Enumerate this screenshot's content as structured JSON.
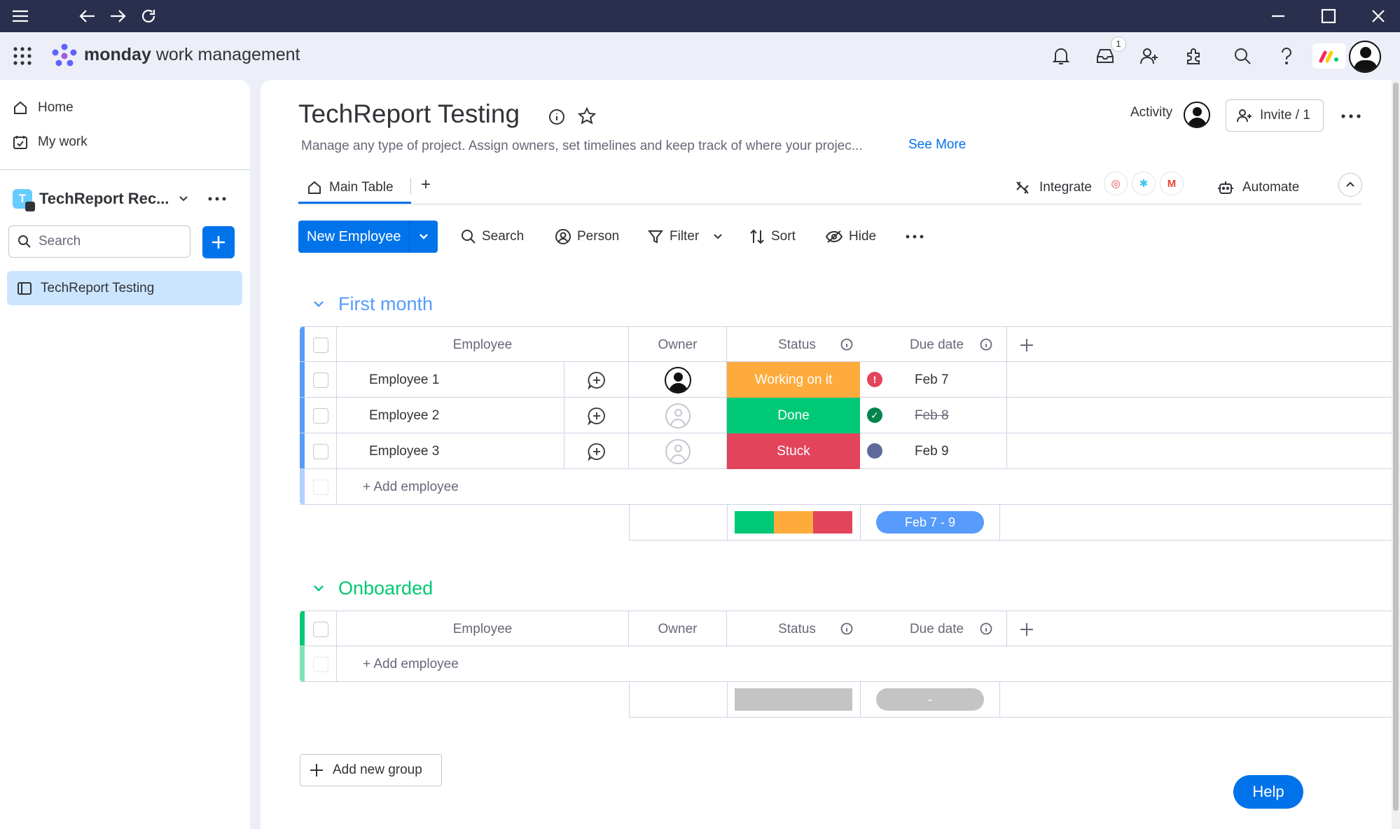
{
  "app": {
    "brand_bold": "monday",
    "brand_rest": "work management",
    "inbox_badge": "1"
  },
  "sidebar": {
    "home": "Home",
    "my_work": "My work",
    "workspace_letter": "T",
    "workspace_name": "TechReport Rec...",
    "search_placeholder": "Search",
    "board_item": "TechReport Testing"
  },
  "board": {
    "title": "TechReport Testing",
    "description": "Manage any type of project. Assign owners, set timelines and keep track of where your projec...",
    "see_more": "See More",
    "activity": "Activity",
    "invite": "Invite / 1",
    "tab_main": "Main Table",
    "tab_add": "+",
    "integrate": "Integrate",
    "automate": "Automate"
  },
  "toolbar": {
    "new_item": "New Employee",
    "search": "Search",
    "person": "Person",
    "filter": "Filter",
    "sort": "Sort",
    "hide": "Hide"
  },
  "columns": {
    "employee": "Employee",
    "owner": "Owner",
    "status": "Status",
    "due_date": "Due date"
  },
  "groups": [
    {
      "name": "First month",
      "color": "#579bfc",
      "rows": [
        {
          "name": "Employee 1",
          "owner": "assigned",
          "status": "Working on it",
          "status_color": "#fdab3d",
          "date": "Feb 7",
          "date_state": "overdue",
          "date_icon_color": "#e2445c"
        },
        {
          "name": "Employee 2",
          "owner": "empty",
          "status": "Done",
          "status_color": "#00c875",
          "date": "Feb 8",
          "date_state": "done",
          "date_icon_color": "#00854d"
        },
        {
          "name": "Employee 3",
          "owner": "empty",
          "status": "Stuck",
          "status_color": "#e2445c",
          "date": "Feb 9",
          "date_state": "upcoming",
          "date_icon_color": "#5559df"
        }
      ],
      "add_row": "+ Add employee",
      "summary_date": "Feb 7 - 9",
      "summary_status_share": [
        {
          "color": "#00c875",
          "fraction": 0.3333
        },
        {
          "color": "#fdab3d",
          "fraction": 0.3333
        },
        {
          "color": "#e2445c",
          "fraction": 0.3334
        }
      ]
    },
    {
      "name": "Onboarded",
      "color": "#00c875",
      "rows": [],
      "add_row": "+ Add employee",
      "summary_date": "-"
    }
  ],
  "add_group": "Add new group",
  "help": "Help",
  "colors": {
    "primary": "#0073ea",
    "selected_board_bg": "#cce5ff",
    "title_bar": "#292f4c"
  }
}
